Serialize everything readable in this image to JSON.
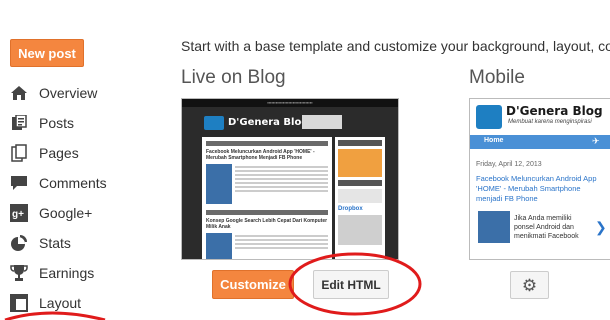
{
  "sidebar": {
    "new_post": "New post",
    "items": [
      {
        "label": "Overview",
        "icon": "home-icon"
      },
      {
        "label": "Posts",
        "icon": "posts-icon"
      },
      {
        "label": "Pages",
        "icon": "pages-icon"
      },
      {
        "label": "Comments",
        "icon": "comment-icon"
      },
      {
        "label": "Google+",
        "icon": "google-plus-icon"
      },
      {
        "label": "Stats",
        "icon": "pie-chart-icon"
      },
      {
        "label": "Earnings",
        "icon": "trophy-icon"
      },
      {
        "label": "Layout",
        "icon": "layout-icon"
      }
    ]
  },
  "main": {
    "intro": "Start with a base template and customize your background, layout, colors,",
    "live_title": "Live on Blog",
    "mobile_title": "Mobile",
    "customize": "Customize",
    "edit_html": "Edit HTML"
  },
  "mobile_preview": {
    "blog_title": "D'Genera Blog",
    "tagline": "Membuat karena menginspirasi",
    "nav_home": "Home",
    "date": "Friday, April 12, 2013",
    "post_title": "Facebook Meluncurkan Android App 'HOME' - Merubah Smartphone menjadi FB Phone",
    "snippet": "Jika Anda memiliki ponsel Android dan menikmati Facebook"
  },
  "blog_preview": {
    "blog_title": "D'Genera Blog",
    "post1": "Facebook Meluncurkan Android App 'HOME' - Merubah Smartphone Menjadi FB Phone",
    "post2": "Konsep Google Search Lebih Cepat Dari Komputer Milik Anak",
    "widget": "Dropbox"
  },
  "colors": {
    "accent_orange": "#f4863f",
    "annotation_red": "#e01b1b"
  }
}
